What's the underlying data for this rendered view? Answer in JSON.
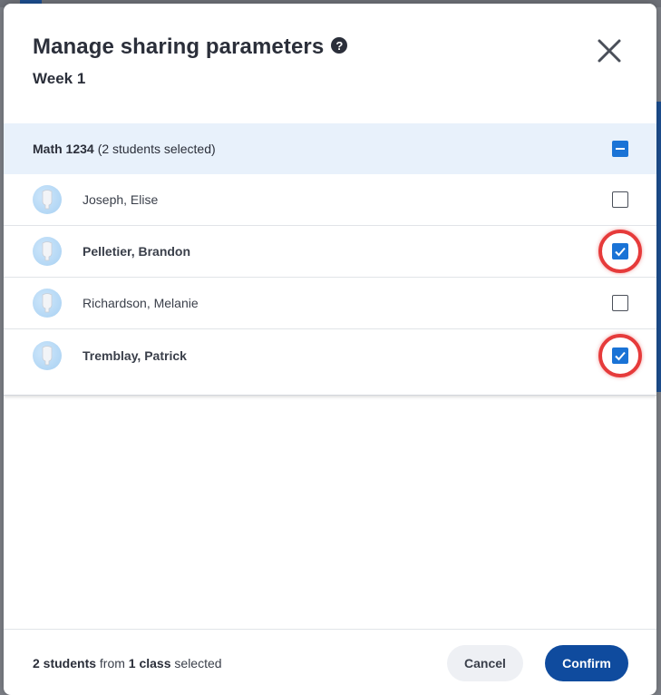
{
  "modal": {
    "title": "Manage sharing parameters",
    "help_icon": "question-circle-icon",
    "subtitle": "Week 1",
    "close_icon": "close-icon"
  },
  "class_group": {
    "name": "Math 1234",
    "count_text": "(2 students selected)",
    "selection_state": "partial"
  },
  "students": [
    {
      "name": "Joseph, Elise",
      "checked": false,
      "bold": false
    },
    {
      "name": "Pelletier, Brandon",
      "checked": true,
      "bold": true
    },
    {
      "name": "Richardson, Melanie",
      "checked": false,
      "bold": false
    },
    {
      "name": "Tremblay, Patrick",
      "checked": true,
      "bold": true
    }
  ],
  "footer": {
    "student_count": "2 students",
    "from_text": "from",
    "class_count": "1 class",
    "selected_text": "selected",
    "cancel_label": "Cancel",
    "confirm_label": "Confirm"
  },
  "colors": {
    "accent": "#1a73d6",
    "confirm": "#0f4b9e",
    "highlight": "#e63b3b",
    "class_row_bg": "#e8f1fb"
  }
}
